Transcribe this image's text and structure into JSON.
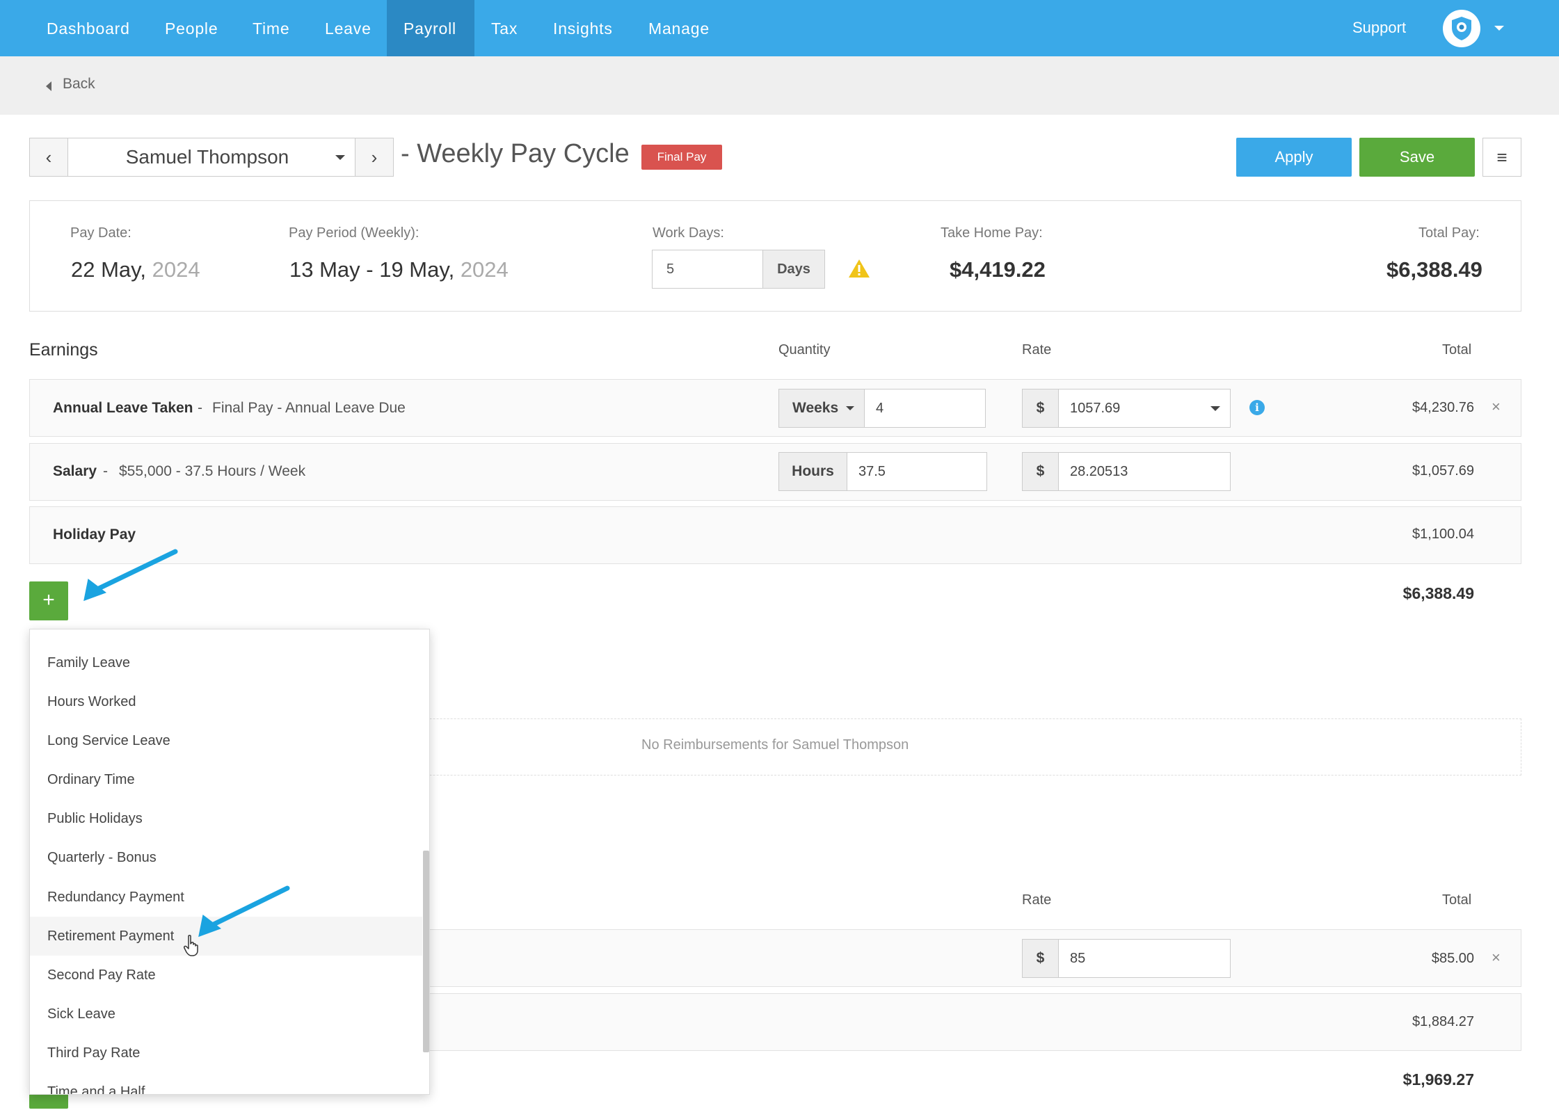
{
  "nav": {
    "items": [
      "Dashboard",
      "People",
      "Time",
      "Leave",
      "Payroll",
      "Tax",
      "Insights",
      "Manage"
    ],
    "active": "Payroll",
    "support": "Support"
  },
  "back": "Back",
  "header": {
    "employee": "Samuel Thompson",
    "cycle": "- Weekly Pay Cycle",
    "badge": "Final Pay",
    "apply": "Apply",
    "save": "Save"
  },
  "summary": {
    "pay_date_label": "Pay Date:",
    "pay_date": "22 May,",
    "pay_date_year": "2024",
    "period_label": "Pay Period (Weekly):",
    "period": "13 May - 19 May,",
    "period_year": "2024",
    "work_days_label": "Work Days:",
    "work_days": "5",
    "work_days_unit": "Days",
    "take_home_label": "Take Home Pay:",
    "take_home": "$4,419.22",
    "total_label": "Total Pay:",
    "total": "$6,388.49"
  },
  "earnings": {
    "title": "Earnings",
    "col_quantity": "Quantity",
    "col_rate": "Rate",
    "col_total": "Total",
    "rows": [
      {
        "name": "Annual Leave Taken",
        "sep": "-",
        "desc": "Final Pay - Annual Leave Due",
        "unit": "Weeks",
        "qty": "4",
        "currency": "$",
        "rate": "1057.69",
        "total": "$4,230.76"
      },
      {
        "name": "Salary",
        "sep": "-",
        "desc": "$55,000 - 37.5 Hours / Week",
        "unit": "Hours",
        "qty": "37.5",
        "currency": "$",
        "rate": "28.20513",
        "total": "$1,057.69"
      },
      {
        "name": "Holiday Pay",
        "total": "$1,100.04"
      }
    ],
    "grand_total": "$6,388.49"
  },
  "reimbursements": {
    "empty_text": "No Reimbursements for Samuel Thompson"
  },
  "deductions": {
    "col_rate": "Rate",
    "col_total": "Total",
    "rows": [
      {
        "currency": "$",
        "rate": "85",
        "total": "$85.00"
      },
      {
        "total": "$1,884.27"
      }
    ],
    "grand_total": "$1,969.27"
  },
  "dropdown": {
    "items": [
      "Family Leave",
      "Hours Worked",
      "Long Service Leave",
      "Ordinary Time",
      "Public Holidays",
      "Quarterly - Bonus",
      "Redundancy Payment",
      "Retirement Payment",
      "Second Pay Rate",
      "Sick Leave",
      "Third Pay Rate",
      "Time and a Half"
    ],
    "hovered": "Retirement Payment"
  },
  "colors": {
    "nav_bg": "#3aa9e8",
    "nav_active": "#2b89c4",
    "save_green": "#5aaa3c",
    "badge_red": "#d9534f",
    "warning_yellow": "#f0c419",
    "annotation_arrow": "#1aa3e0"
  },
  "icons": [
    "chevron-left-icon",
    "chevron-right-icon",
    "caret-down-icon",
    "hamburger-menu-icon",
    "warning-icon",
    "info-icon",
    "close-icon",
    "plus-icon",
    "pointer-hand-icon",
    "annotation-arrow-icon"
  ]
}
